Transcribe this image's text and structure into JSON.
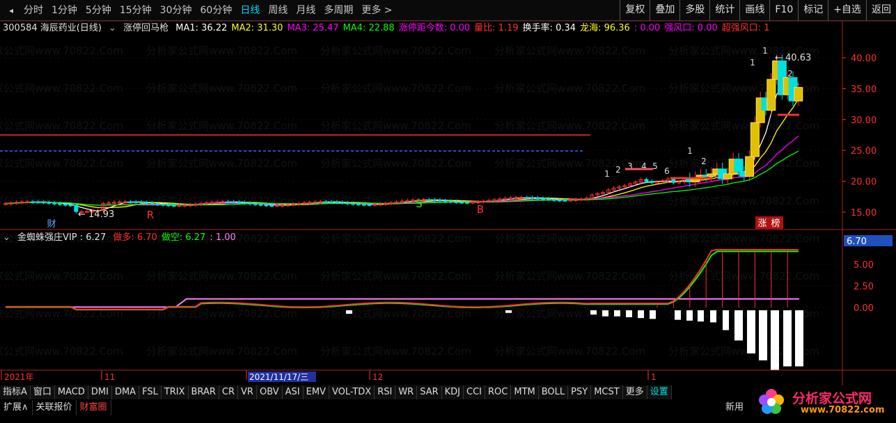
{
  "toolbar": {
    "periods": [
      "分时",
      "1分钟",
      "5分钟",
      "15分钟",
      "30分钟",
      "60分钟",
      "日线",
      "周线",
      "月线",
      "多周期",
      "更多 >"
    ],
    "active_period": "日线",
    "tools": [
      "复权",
      "叠加",
      "多股",
      "统计",
      "画线",
      "F10",
      "标记",
      "+自选",
      "返回"
    ]
  },
  "main_panel": {
    "stock": "300584 海辰药业(日线)",
    "indicator": "涨停回马枪",
    "fields": [
      {
        "label": "MA1: 36.22",
        "color": "#ffffff"
      },
      {
        "label": "MA2: 31.30",
        "color": "#ffff00"
      },
      {
        "label": "MA3: 25.47",
        "color": "#ff00ff"
      },
      {
        "label": "MA4: 22.88",
        "color": "#00ff00"
      },
      {
        "label": "涨停距今数: 0.00",
        "color": "#ff00ff"
      },
      {
        "label": "量比: 1.19",
        "color": "#ff3030"
      },
      {
        "label": "换手率: 0.34",
        "color": "#ffffff"
      },
      {
        "label": "龙海: 96.36",
        "color": "#ffff00"
      },
      {
        "label": ": 0.00",
        "color": "#ff00ff"
      },
      {
        "label": "强风口: 0.00",
        "color": "#ff00ff"
      },
      {
        "label": "超强风口: 1",
        "color": "#ff3030"
      }
    ],
    "y_ticks": [
      "40.00",
      "35.00",
      "30.00",
      "25.00",
      "20.00",
      "15.00"
    ],
    "high_label": "40.63",
    "low_label": "14.93",
    "markers": {
      "cai": "财",
      "r": "R",
      "s": "S",
      "b": "B",
      "zhang": "涨",
      "bang": "榜"
    },
    "counts": [
      "1",
      "2",
      "3",
      "4",
      "5",
      "6",
      "1",
      "2",
      "1",
      "1",
      "2"
    ]
  },
  "indicator_panel": {
    "name": "金蜘蛛强庄VIP",
    "value": ": 6.27",
    "fields": [
      {
        "label": "做多: 6.70",
        "color": "#ff3030"
      },
      {
        "label": "做空: 6.27",
        "color": "#00ff00"
      },
      {
        "label": ": 1.00",
        "color": "#ff80ff"
      }
    ],
    "y_ticks": [
      "5.00",
      "2.50",
      "0.00"
    ],
    "current_value": "6.70"
  },
  "time_axis": {
    "labels": [
      "2021年",
      "11",
      "2021/11/17/三",
      "12",
      "1"
    ]
  },
  "tabs_row1": [
    "指标A",
    "窗口",
    "MACD",
    "DMI",
    "DMA",
    "FSL",
    "TRIX",
    "BRAR",
    "CR",
    "VR",
    "OBV",
    "ASI",
    "EMV",
    "VOL-TDX",
    "RSI",
    "WR",
    "SAR",
    "KDJ",
    "CCI",
    "ROC",
    "MTM",
    "BOLL",
    "PSY",
    "MCST",
    "更多",
    "设置"
  ],
  "tabs_row2": [
    "扩展∧",
    "关联报价",
    "财富圈"
  ],
  "new_use": "新用",
  "logo": {
    "name": "分析家公式网",
    "url": "www.70822.com"
  },
  "watermark": "分析家公式网www.70822.Com"
}
